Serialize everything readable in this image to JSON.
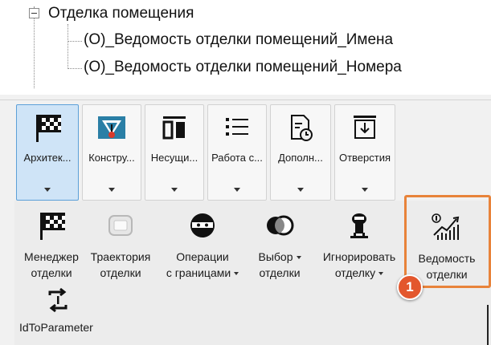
{
  "tree": {
    "root_label": "Отделка помещения",
    "children": [
      "(О)_Ведомость отделки помещений_Имена",
      "(О)_Ведомость отделки помещений_Номера"
    ]
  },
  "ribbon": {
    "buttons": [
      {
        "label": "Архитек...",
        "icon": "checkered-flag-icon",
        "selected": true
      },
      {
        "label": "Констру...",
        "icon": "structure-triangle-icon",
        "selected": false
      },
      {
        "label": "Несущи...",
        "icon": "bearing-wall-icon",
        "selected": false
      },
      {
        "label": "Работа с...",
        "icon": "list-icon",
        "selected": false
      },
      {
        "label": "Дополн...",
        "icon": "document-clock-icon",
        "selected": false
      },
      {
        "label": "Отверстия",
        "icon": "opening-icon",
        "selected": false
      }
    ]
  },
  "panel": {
    "items": [
      {
        "line1": "Менеджер",
        "line2": "отделки",
        "icon": "checkered-flag-icon",
        "dropdown": false
      },
      {
        "line1": "Траектория",
        "line2": "отделки",
        "icon": "trajectory-icon",
        "dropdown": false
      },
      {
        "line1": "Операции",
        "line2": "с границами",
        "icon": "ninja-icon",
        "dropdown": true
      },
      {
        "line1": "Выбор",
        "line2": "отделки",
        "icon": "venn-circles-icon",
        "dropdown": true
      },
      {
        "line1": "Игнорировать",
        "line2": "отделку",
        "icon": "ignore-figure-icon",
        "dropdown": true
      },
      {
        "line1": "Ведомость",
        "line2": "отделки",
        "icon": "statement-chart-icon",
        "dropdown": false
      },
      {
        "line1": "IdToParameter",
        "line2": "",
        "icon": "refresh-id-icon",
        "dropdown": false
      }
    ]
  },
  "callout": {
    "number": "1",
    "color": "#e3572d",
    "highlight_color": "#e8833a"
  },
  "colors": {
    "selected_bg": "#cfe4f7",
    "selected_border": "#5ca0d8"
  }
}
